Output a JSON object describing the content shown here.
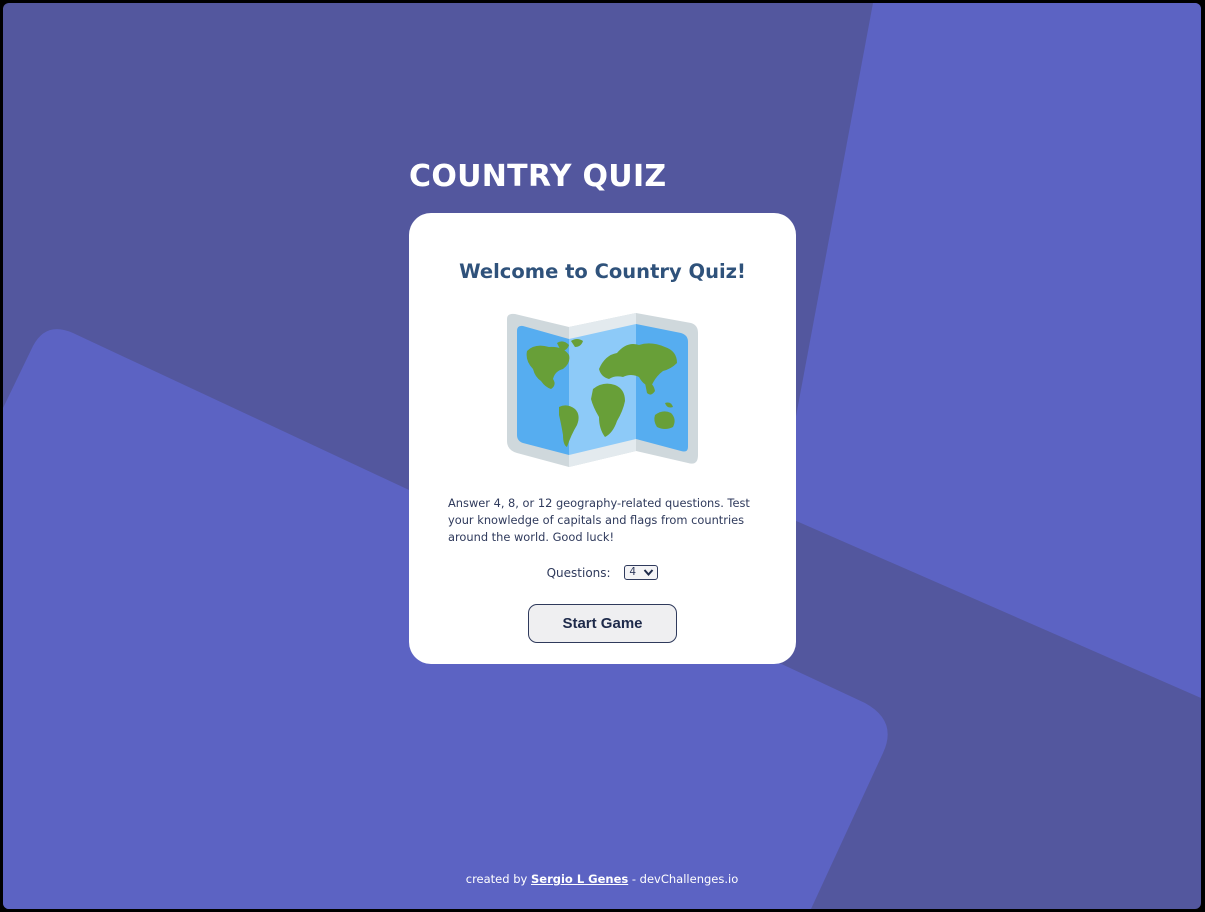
{
  "app": {
    "title": "COUNTRY QUIZ"
  },
  "card": {
    "heading": "Welcome to Country Quiz!",
    "illustration_icon": "world-map-icon",
    "description": "Answer 4, 8, or 12 geography-related questions. Test your knowledge of capitals and flags from countries around the world. Good luck!",
    "questions_label": "Questions:",
    "questions_selected": "4",
    "start_button_label": "Start Game"
  },
  "footer": {
    "prefix": "created by ",
    "author": "Sergio L Genes",
    "suffix": " - devChallenges.io"
  },
  "colors": {
    "background": "#53579e",
    "background_light": "#5c63c3",
    "title": "#ffffff",
    "heading": "#2f527b",
    "card": "#ffffff"
  }
}
